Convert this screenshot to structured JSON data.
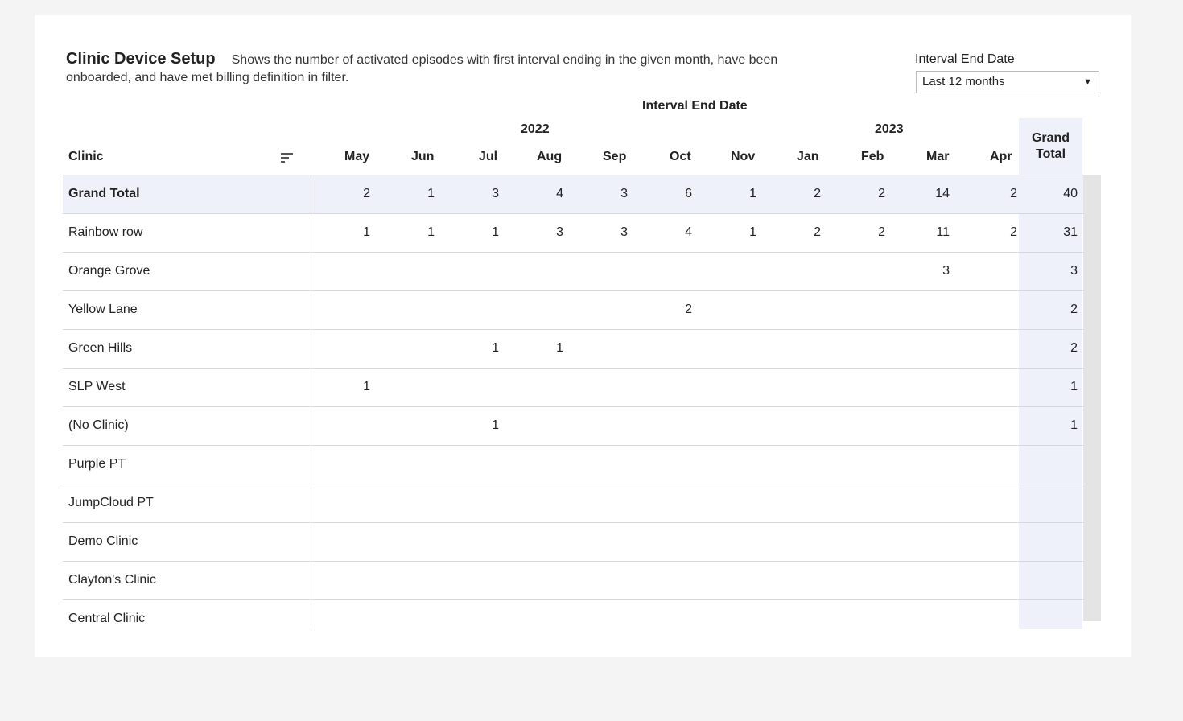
{
  "header": {
    "title": "Clinic Device Setup",
    "description": "Shows the number of activated episodes with first interval ending in the given month, have been onboarded, and have met billing definition in filter."
  },
  "filter": {
    "label": "Interval End Date",
    "value": "Last 12 months"
  },
  "table": {
    "top_header": "Interval End Date",
    "years": [
      "2022",
      "2023"
    ],
    "clinic_header": "Clinic",
    "months": [
      "May",
      "Jun",
      "Jul",
      "Aug",
      "Sep",
      "Oct",
      "Nov",
      "Jan",
      "Feb",
      "Mar",
      "Apr"
    ],
    "grand_total_header": "Grand Total",
    "rows": [
      {
        "clinic": "Grand Total",
        "values": [
          "2",
          "1",
          "3",
          "4",
          "3",
          "6",
          "1",
          "2",
          "2",
          "14",
          "2"
        ],
        "total": "40"
      },
      {
        "clinic": "Rainbow row",
        "values": [
          "1",
          "1",
          "1",
          "3",
          "3",
          "4",
          "1",
          "2",
          "2",
          "11",
          "2"
        ],
        "total": "31"
      },
      {
        "clinic": "Orange Grove",
        "values": [
          "",
          "",
          "",
          "",
          "",
          "",
          "",
          "",
          "",
          "3",
          ""
        ],
        "total": "3"
      },
      {
        "clinic": "Yellow Lane",
        "values": [
          "",
          "",
          "",
          "",
          "",
          "2",
          "",
          "",
          "",
          "",
          ""
        ],
        "total": "2"
      },
      {
        "clinic": "Green Hills",
        "values": [
          "",
          "",
          "1",
          "1",
          "",
          "",
          "",
          "",
          "",
          "",
          ""
        ],
        "total": "2"
      },
      {
        "clinic": "SLP West",
        "values": [
          "1",
          "",
          "",
          "",
          "",
          "",
          "",
          "",
          "",
          "",
          ""
        ],
        "total": "1"
      },
      {
        "clinic": "(No Clinic)",
        "values": [
          "",
          "",
          "1",
          "",
          "",
          "",
          "",
          "",
          "",
          "",
          ""
        ],
        "total": "1"
      },
      {
        "clinic": "Purple PT",
        "values": [
          "",
          "",
          "",
          "",
          "",
          "",
          "",
          "",
          "",
          "",
          ""
        ],
        "total": ""
      },
      {
        "clinic": "JumpCloud PT",
        "values": [
          "",
          "",
          "",
          "",
          "",
          "",
          "",
          "",
          "",
          "",
          ""
        ],
        "total": ""
      },
      {
        "clinic": "Demo Clinic",
        "values": [
          "",
          "",
          "",
          "",
          "",
          "",
          "",
          "",
          "",
          "",
          ""
        ],
        "total": ""
      },
      {
        "clinic": "Clayton's Clinic",
        "values": [
          "",
          "",
          "",
          "",
          "",
          "",
          "",
          "",
          "",
          "",
          ""
        ],
        "total": ""
      },
      {
        "clinic": "Central Clinic",
        "values": [
          "",
          "",
          "",
          "",
          "",
          "",
          "",
          "",
          "",
          "",
          ""
        ],
        "total": ""
      }
    ]
  },
  "colors": {
    "grand_total_bg": "#eef1fa",
    "grid_line": "#d8d8d8"
  }
}
